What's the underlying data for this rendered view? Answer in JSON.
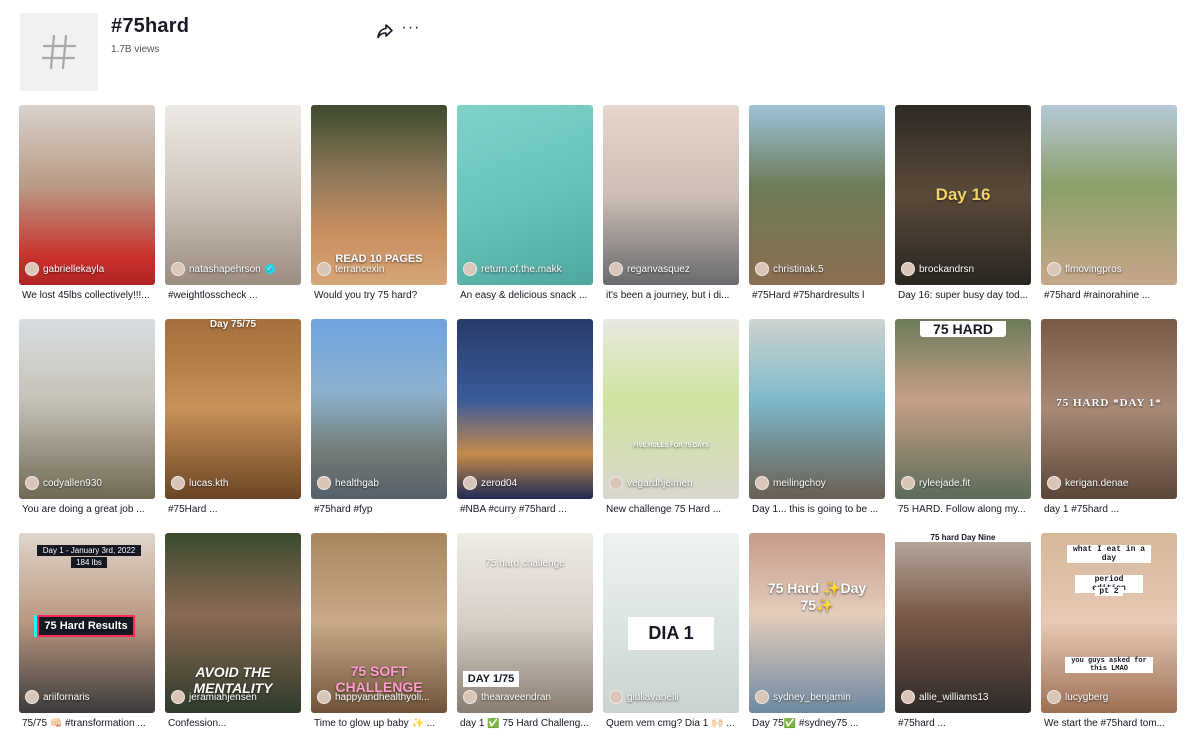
{
  "header": {
    "icon": "hashtag-icon",
    "title": "#75hard",
    "views": "1.7B views",
    "share_icon": "share-icon",
    "more_label": "···"
  },
  "videos": [
    {
      "author": "gabriellekayla",
      "caption": "We lost 45lbs collectively!!!...",
      "verified": false,
      "overlay": ""
    },
    {
      "author": "natashapehrson",
      "caption": "#weightlosscheck ...",
      "verified": true,
      "overlay": ""
    },
    {
      "author": "terrancexin",
      "caption": "Would you try 75 hard?",
      "verified": false,
      "overlay": "READ 10 PAGES"
    },
    {
      "author": "return.of.the.makk",
      "caption": "An easy & delicious snack ...",
      "verified": false,
      "overlay": ""
    },
    {
      "author": "reganvasquez",
      "caption": "it's been a journey, but i di...",
      "verified": false,
      "overlay": ""
    },
    {
      "author": "christinak.5",
      "caption": "#75Hard #75hardresults l",
      "verified": false,
      "overlay": ""
    },
    {
      "author": "brockandrsn",
      "caption": "Day 16: super busy day tod...",
      "verified": false,
      "overlay": "Day 16"
    },
    {
      "author": "flmovingpros",
      "caption": "#75hard #rainorahine ...",
      "verified": false,
      "overlay": ""
    },
    {
      "author": "codyallen930",
      "caption": "You are doing a great job ...",
      "verified": false,
      "overlay": ""
    },
    {
      "author": "lucas.kth",
      "caption": "#75Hard ...",
      "verified": false,
      "overlay": "Day 75/75"
    },
    {
      "author": "healthgab",
      "caption": "#75hard #fyp",
      "verified": false,
      "overlay": ""
    },
    {
      "author": "zerod04",
      "caption": "#NBA #curry #75hard ...",
      "verified": false,
      "overlay": ""
    },
    {
      "author": "vegardhjelmen",
      "caption": "New challenge 75 Hard ...",
      "verified": false,
      "overlay": "FIVE RULES FOR 75 DAYS"
    },
    {
      "author": "meilingchoy",
      "caption": "Day 1... this is going to be ...",
      "verified": false,
      "overlay": ""
    },
    {
      "author": "ryleejade.fit",
      "caption": "75 HARD. Follow along my...",
      "verified": false,
      "overlay": "75 HARD"
    },
    {
      "author": "kerigan.denae",
      "caption": "day 1 #75hard ...",
      "verified": false,
      "overlay": "75 HARD *DAY 1*"
    },
    {
      "author": "ariifornaris",
      "caption": "75/75 👊🏻 #transformation ...",
      "verified": false,
      "overlay": "75 Hard Results"
    },
    {
      "author": "jeramiahjensen",
      "caption": "Confession...",
      "verified": false,
      "overlay": "AVOID THE MENTALITY"
    },
    {
      "author": "happyandhealthyoli...",
      "caption": "Time to glow up baby ✨ ...",
      "verified": false,
      "overlay": "75 SOFT CHALLENGE"
    },
    {
      "author": "thearaveendran",
      "caption": "day 1 ✅ 75 Hard Challeng...",
      "verified": false,
      "overlay": "75 hard challenge"
    },
    {
      "author": "giuliavanelli",
      "caption": "Quem vem cmg? Dia 1 🙌🏻 ...",
      "verified": false,
      "overlay": "DIA 1"
    },
    {
      "author": "sydney_benjamin",
      "caption": "Day 75✅ #sydney75 ...",
      "verified": false,
      "overlay": "75 Hard ✨Day 75✨"
    },
    {
      "author": "allie_williams13",
      "caption": "#75hard ...",
      "verified": false,
      "overlay": "75 hard Day Nine"
    },
    {
      "author": "lucygberg",
      "caption": "We start the #75hard tom...",
      "verified": false,
      "overlay": "what I eat in a day"
    }
  ],
  "extra_text": {
    "card17_sub": "Day 1 - January 3rd, 2022",
    "card17_weight": "184 lbs",
    "card20_day": "DAY 1/75",
    "card24_sub1": "period edition",
    "card24_sub2": "pt 2",
    "card24_sub3": "you guys asked for this LMAO"
  },
  "colors": {
    "accent": "#fe2c55",
    "verified": "#20d5ec",
    "text": "#161823",
    "muted": "#555555",
    "placeholder": "#f1f1f2"
  }
}
